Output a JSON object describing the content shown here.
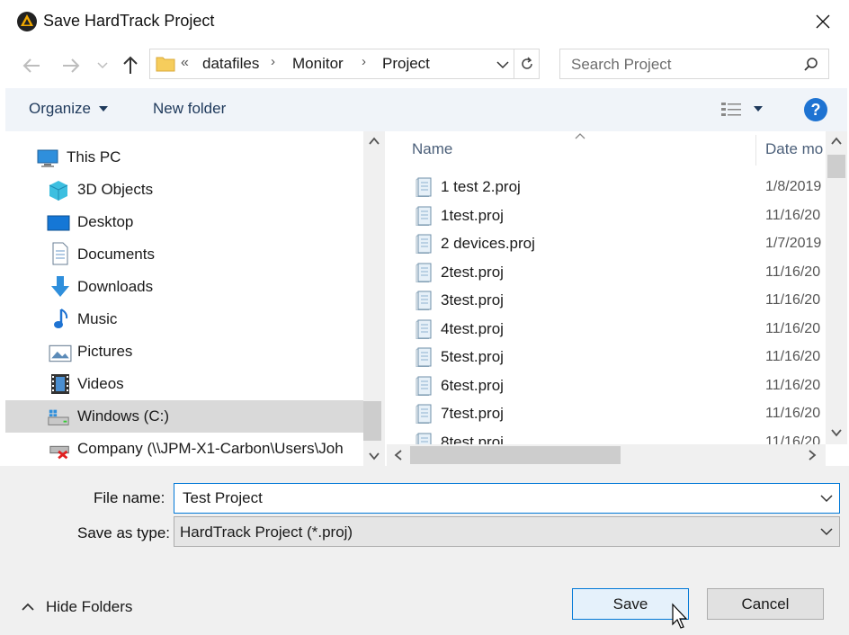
{
  "window": {
    "title": "Save HardTrack Project"
  },
  "address": {
    "overflow": "«",
    "crumbs": [
      "datafiles",
      "Monitor",
      "Project"
    ],
    "search_placeholder": "Search Project"
  },
  "toolbar": {
    "organize_label": "Organize",
    "new_folder_label": "New folder",
    "help_label": "?"
  },
  "sidebar": {
    "items": [
      {
        "label": "This PC",
        "icon": "computer-icon"
      },
      {
        "label": "3D Objects",
        "icon": "cube-icon"
      },
      {
        "label": "Desktop",
        "icon": "desktop-icon"
      },
      {
        "label": "Documents",
        "icon": "document-icon"
      },
      {
        "label": "Downloads",
        "icon": "download-arrow-icon"
      },
      {
        "label": "Music",
        "icon": "music-note-icon"
      },
      {
        "label": "Pictures",
        "icon": "picture-icon"
      },
      {
        "label": "Videos",
        "icon": "film-icon"
      },
      {
        "label": "Windows (C:)",
        "icon": "drive-icon",
        "selected": true
      },
      {
        "label": "Company (\\\\JPM-X1-Carbon\\Users\\Joh",
        "icon": "network-drive-icon"
      }
    ]
  },
  "files": {
    "columns": {
      "name": "Name",
      "date": "Date mo"
    },
    "rows": [
      {
        "name": "1 test 2.proj",
        "date": "1/8/2019"
      },
      {
        "name": "1test.proj",
        "date": "11/16/20"
      },
      {
        "name": "2 devices.proj",
        "date": "1/7/2019"
      },
      {
        "name": "2test.proj",
        "date": "11/16/20"
      },
      {
        "name": "3test.proj",
        "date": "11/16/20"
      },
      {
        "name": "4test.proj",
        "date": "11/16/20"
      },
      {
        "name": "5test.proj",
        "date": "11/16/20"
      },
      {
        "name": "6test.proj",
        "date": "11/16/20"
      },
      {
        "name": "7test.proj",
        "date": "11/16/20"
      },
      {
        "name": "8test.proj",
        "date": "11/16/20"
      }
    ]
  },
  "form": {
    "file_name_label": "File name:",
    "file_name_value": "Test Project",
    "save_type_label": "Save as type:",
    "save_type_value": "HardTrack Project (*.proj)"
  },
  "footer": {
    "hide_folders_label": "Hide Folders",
    "save_label": "Save",
    "cancel_label": "Cancel"
  },
  "colors": {
    "accent": "#0078d7",
    "selection": "#d9d9d9",
    "toolbar": "#f0f4f9",
    "help": "#1e73d2"
  }
}
